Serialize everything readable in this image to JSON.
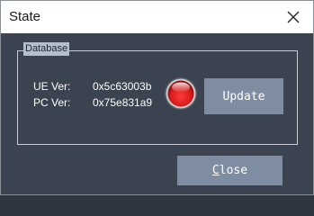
{
  "window": {
    "title": "State"
  },
  "database_group": {
    "label": "Database",
    "ue_version_label": "UE Ver:",
    "ue_version_value": "0x5c63003b",
    "pc_version_label": "PC Ver:",
    "pc_version_value": "0x75e831a9",
    "status_color": "#d81b1b"
  },
  "buttons": {
    "update_label": "Update",
    "close_mnemonic": "C",
    "close_rest": "lose"
  },
  "icons": {
    "window_close": "close-icon",
    "status": "status-led-icon"
  }
}
